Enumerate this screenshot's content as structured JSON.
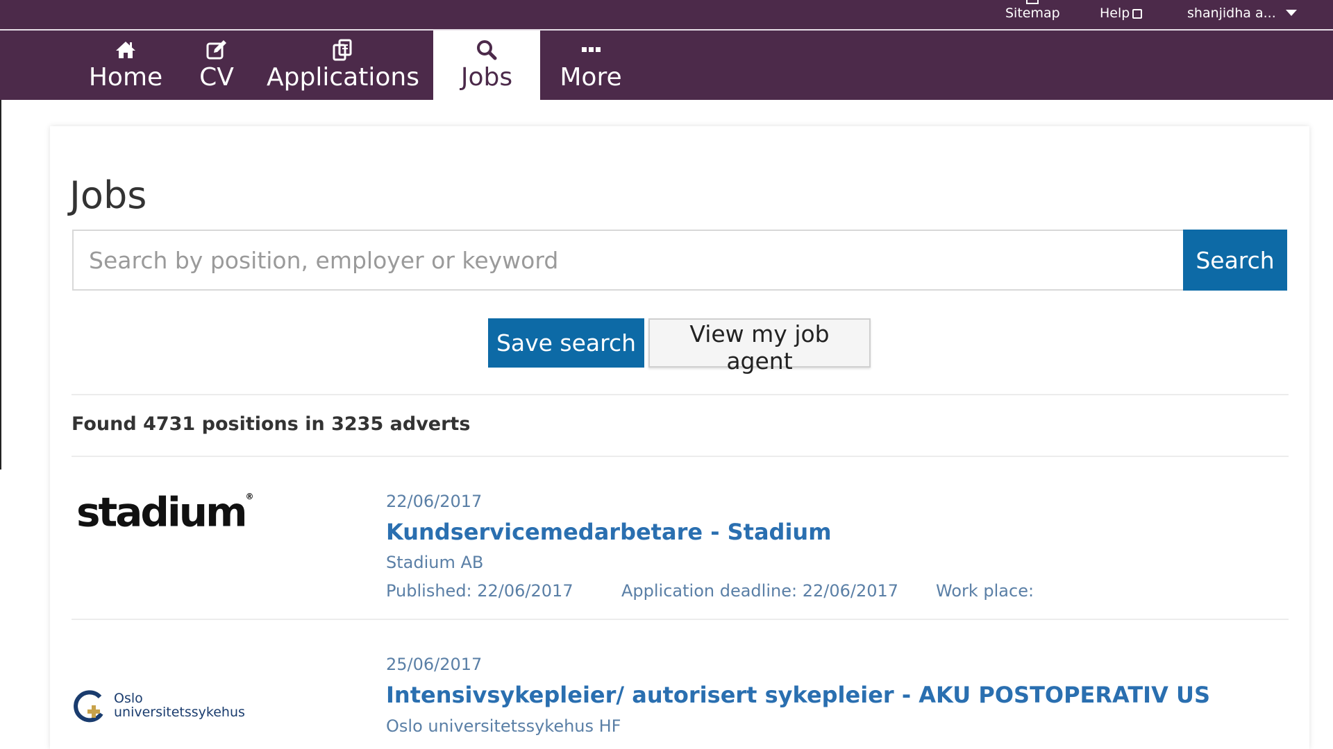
{
  "utility_bar": {
    "sitemap_label": "Sitemap",
    "help_label": "Help",
    "user_label": "shanjidha a..."
  },
  "nav": {
    "items": [
      {
        "label": "Home",
        "icon": "home-icon"
      },
      {
        "label": "CV",
        "icon": "edit-icon"
      },
      {
        "label": "Applications",
        "icon": "applications-icon"
      },
      {
        "label": "Jobs",
        "icon": "search-icon",
        "active": true
      },
      {
        "label": "More",
        "icon": "more-icon"
      }
    ]
  },
  "page": {
    "title": "Jobs",
    "search": {
      "placeholder": "Search by position, employer or keyword",
      "value": "",
      "button_label": "Search"
    },
    "save_search_label": "Save search",
    "view_agent_label": "View my job agent",
    "results_summary": "Found 4731 positions in 3235 adverts"
  },
  "jobs": [
    {
      "logo_text": "stadium",
      "date": "22/06/2017",
      "title": "Kundservicemedarbetare - Stadium",
      "company": "Stadium AB",
      "published": "Published: 22/06/2017",
      "deadline": "Application deadline: 22/06/2017",
      "workplace": "Work place:"
    },
    {
      "logo_text_line1": "Oslo",
      "logo_text_line2": "universitetssykehus",
      "date": "25/06/2017",
      "title": "Intensivsykepleier/ autorisert sykepleier - AKU POSTOPERATIV US",
      "company": "Oslo universitetssykehus HF"
    }
  ],
  "colors": {
    "brand_purple": "#4c2a4a",
    "primary_blue": "#0d6aa6",
    "link_blue": "#2a6fb0",
    "meta_blue": "#5a7fa6"
  }
}
